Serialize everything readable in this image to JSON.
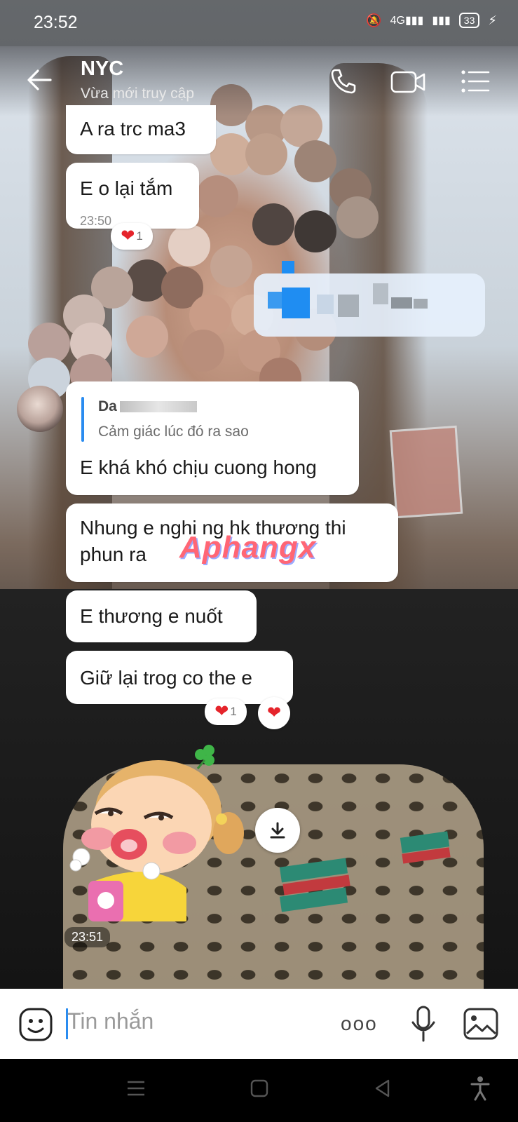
{
  "status_bar": {
    "time": "23:52",
    "network": "4G",
    "battery": "33"
  },
  "header": {
    "title": "NYC",
    "subtitle": "Vừa mới truy cập",
    "icons": [
      "back-arrow-icon",
      "phone-icon",
      "video-icon",
      "menu-list-icon"
    ]
  },
  "messages": [
    {
      "text": "A ra trc ma3"
    },
    {
      "text": "E o lại tắm",
      "time": "23:50",
      "reaction_count": "1"
    },
    {
      "quote_name": "Da",
      "quote_text": "Cảm giác lúc đó ra sao",
      "text": "E khá khó chịu cuong hong"
    },
    {
      "text": "Nhung e nghi ng hk thương thi phun ra"
    },
    {
      "text": "E thương e nuốt"
    },
    {
      "text": "Giữ lại trog co the e",
      "reaction_count": "1"
    }
  ],
  "watermark": "Aphangx",
  "sticker": {
    "time": "23:51"
  },
  "composer": {
    "placeholder": "Tin nhắn",
    "more_label": "ooo"
  },
  "colors": {
    "accent": "#2a8cf0",
    "heart": "#e5242b",
    "bubble": "#ffffff"
  }
}
